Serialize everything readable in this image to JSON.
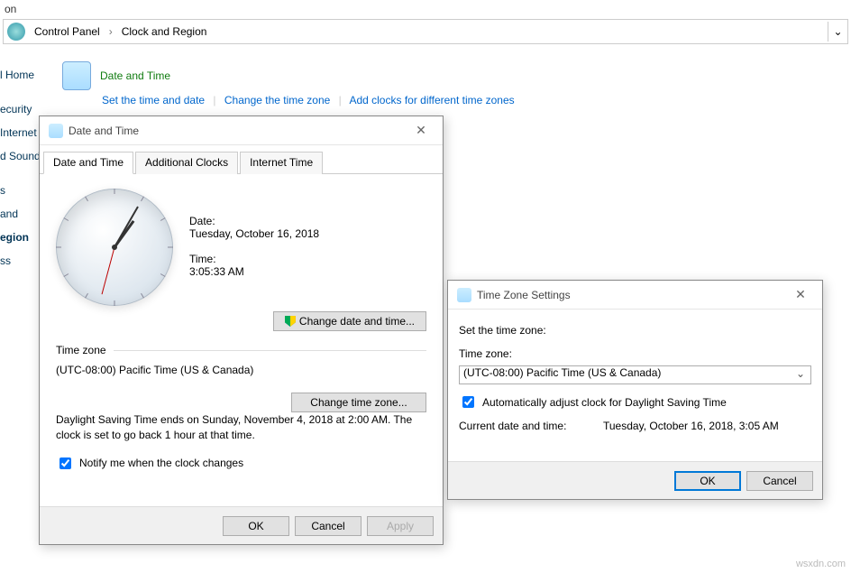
{
  "top_title_suffix": "on",
  "breadcrumb": {
    "a": "Control Panel",
    "b": "Clock and Region"
  },
  "leftnav": {
    "home": "l Home",
    "security": "ecurity",
    "internet": " Internet",
    "sound": "d Sound",
    "s": "s",
    "and": "and",
    "egion": "egion",
    "ss": "ss"
  },
  "main_title": "Date and Time",
  "main_links": {
    "a": "Set the time and date",
    "b": "Change the time zone",
    "c": "Add clocks for different time zones"
  },
  "dlg1": {
    "title": "Date and Time",
    "tabs": {
      "a": "Date and Time",
      "b": "Additional Clocks",
      "c": "Internet Time"
    },
    "date_lbl": "Date:",
    "date_val": "Tuesday, October 16, 2018",
    "time_lbl": "Time:",
    "time_val": "3:05:33 AM",
    "change_dt": "Change date and time...",
    "tz_head": "Time zone",
    "tz_val": "(UTC-08:00) Pacific Time (US & Canada)",
    "change_tz": "Change time zone...",
    "dst": "Daylight Saving Time ends on Sunday, November 4, 2018 at 2:00 AM. The clock is set to go back 1 hour at that time.",
    "notify": "Notify me when the clock changes",
    "ok": "OK",
    "cancel": "Cancel",
    "apply": "Apply"
  },
  "dlg2": {
    "title": "Time Zone Settings",
    "set": "Set the time zone:",
    "tz_lbl": "Time zone:",
    "tz_sel": "(UTC-08:00) Pacific Time (US & Canada)",
    "auto": "Automatically adjust clock for Daylight Saving Time",
    "cur_lbl": "Current date and time:",
    "cur_val": "Tuesday, October 16, 2018, 3:05 AM",
    "ok": "OK",
    "cancel": "Cancel"
  },
  "watermark": "wsxdn.com"
}
